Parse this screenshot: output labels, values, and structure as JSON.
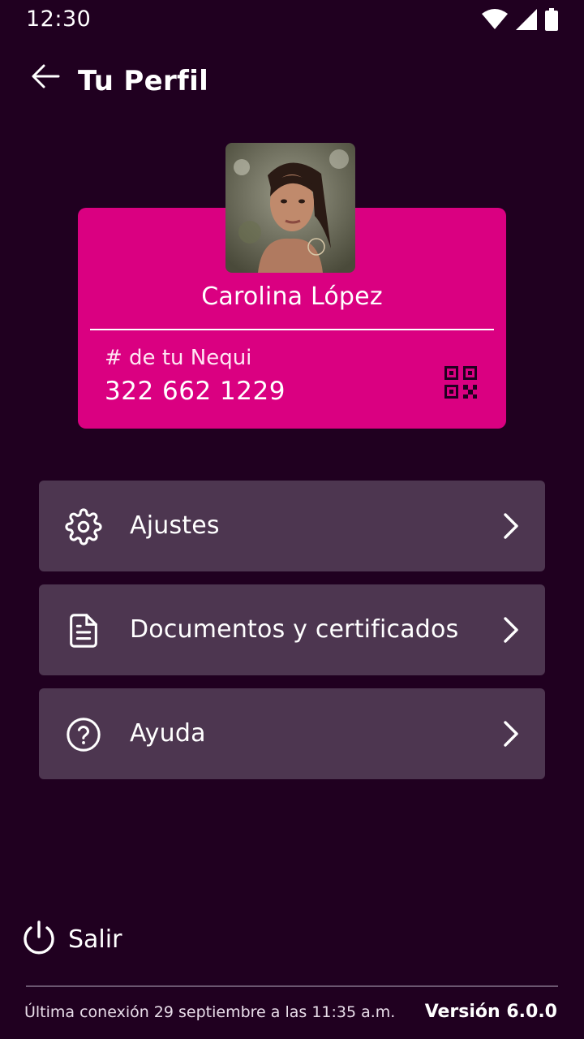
{
  "status_bar": {
    "time": "12:30",
    "icons": [
      "wifi-icon",
      "cellular-signal-icon",
      "battery-icon"
    ]
  },
  "header": {
    "back_icon": "arrow-left-icon",
    "title": "Tu Perfil"
  },
  "profile": {
    "name": "Carolina López",
    "nequi_label": "# de tu Nequi",
    "nequi_number": "322 662 1229",
    "qr_icon": "qr-code-icon"
  },
  "menu": {
    "items": [
      {
        "label": "Ajustes",
        "icon": "gear-icon"
      },
      {
        "label": "Documentos y certificados",
        "icon": "document-icon"
      },
      {
        "label": "Ayuda",
        "icon": "help-circle-icon"
      }
    ]
  },
  "footer": {
    "logout_label": "Salir",
    "logout_icon": "power-icon",
    "last_connection": "Última conexión 29 septiembre a las 11:35 a.m.",
    "version": "Versión 6.0.0"
  },
  "colors": {
    "background": "#200020",
    "card": "#da0081",
    "menu_item": "#4d3650",
    "text": "#ffffff"
  }
}
